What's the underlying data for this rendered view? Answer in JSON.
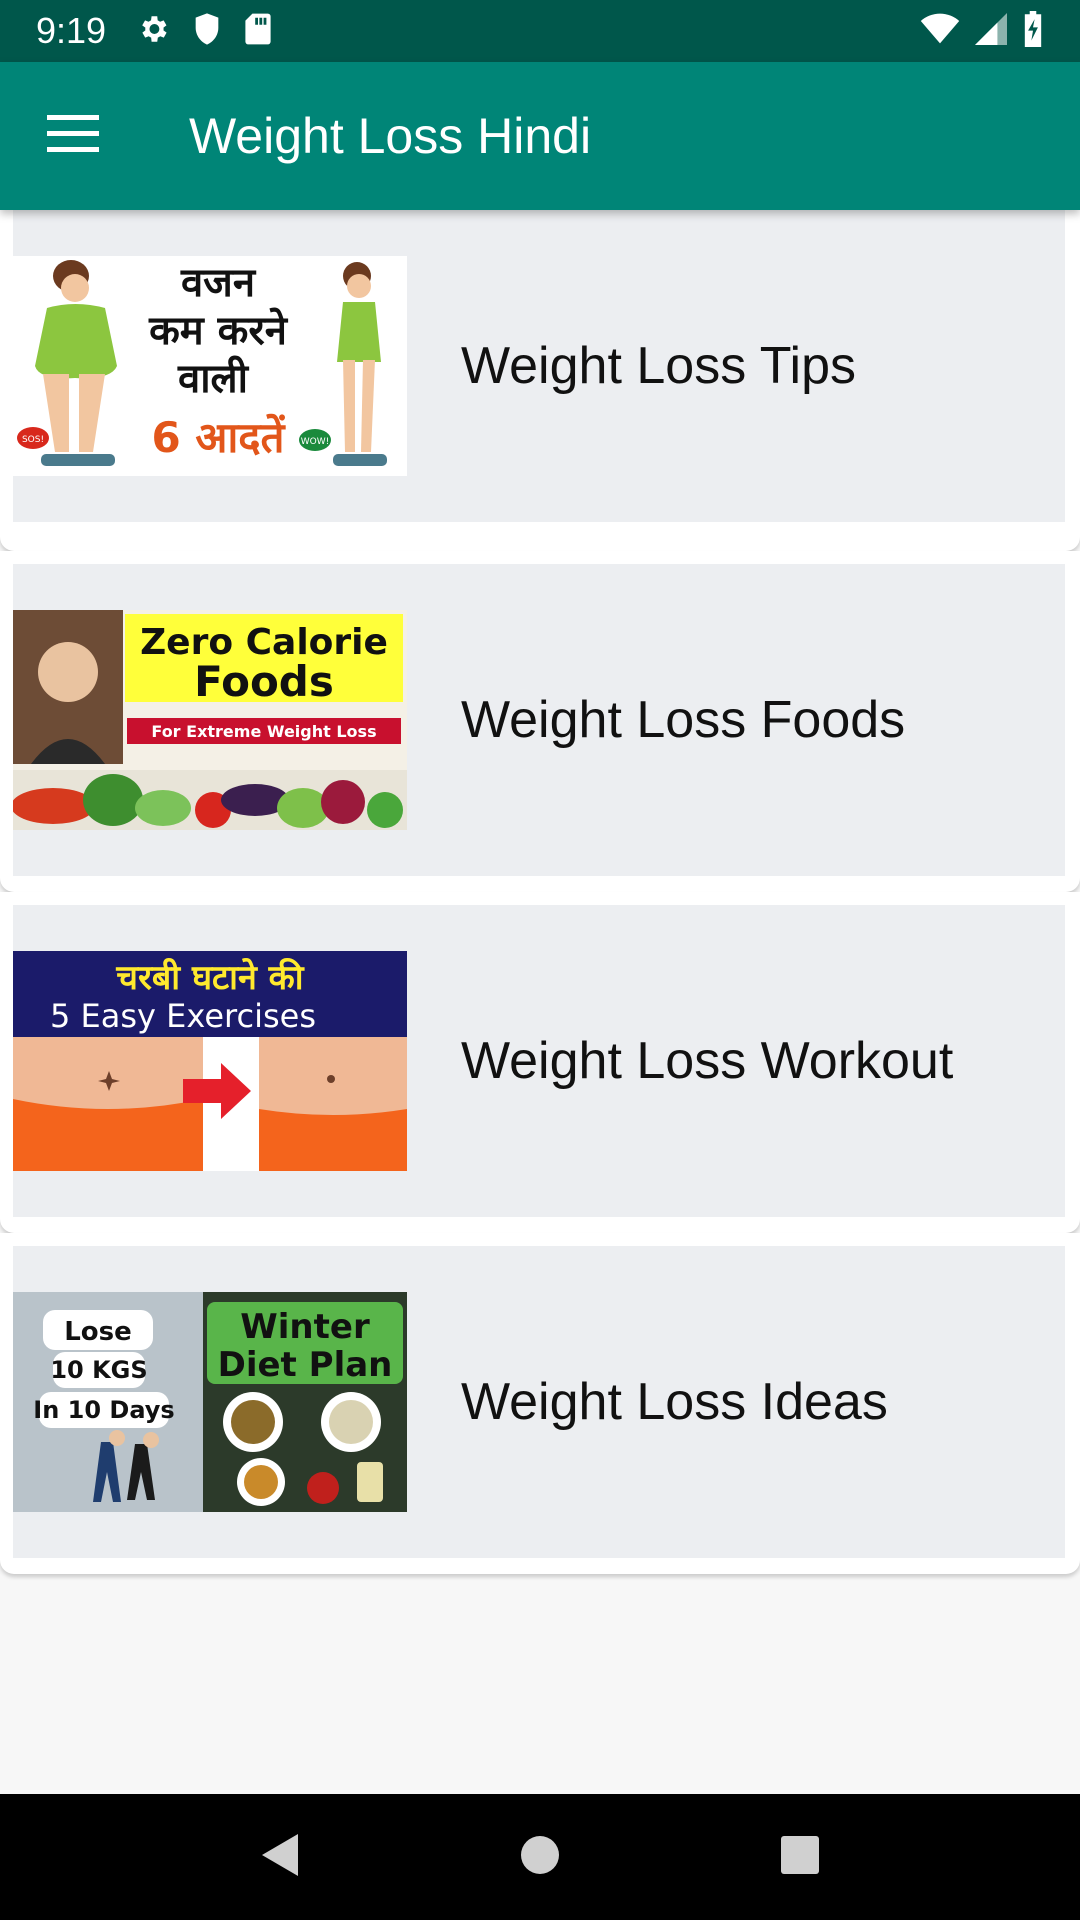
{
  "status_bar": {
    "time": "9:19",
    "icons_left": [
      "gear-icon",
      "shield-icon",
      "sd-card-icon"
    ],
    "icons_right": [
      "wifi-icon",
      "signal-icon",
      "battery-charging-icon"
    ]
  },
  "app_bar": {
    "title": "Weight Loss Hindi",
    "menu_icon": "hamburger-menu-icon",
    "color": "#008577",
    "status_color": "#00574b"
  },
  "items": [
    {
      "label": "Weight Loss Tips",
      "thumbnail": {
        "text_lines": [
          "वजन",
          "कम करने",
          "वाली",
          "6 आदतें"
        ],
        "bubble_left": "SOS!",
        "bubble_right": "WOW!"
      }
    },
    {
      "label": "Weight Loss Foods",
      "thumbnail": {
        "text_lines": [
          "Zero Calorie",
          "Foods",
          "For Extreme Weight Loss"
        ]
      }
    },
    {
      "label": "Weight Loss Workout",
      "thumbnail": {
        "text_lines": [
          "चरबी घटाने की",
          "5 Easy Exercises"
        ]
      }
    },
    {
      "label": "Weight Loss Ideas",
      "thumbnail": {
        "text_lines": [
          "Lose",
          "10 KGS",
          "In 10 Days",
          "Winter",
          "Diet Plan"
        ]
      }
    }
  ],
  "nav_bar": {
    "icons": [
      "back-icon",
      "home-icon",
      "recents-icon"
    ]
  }
}
